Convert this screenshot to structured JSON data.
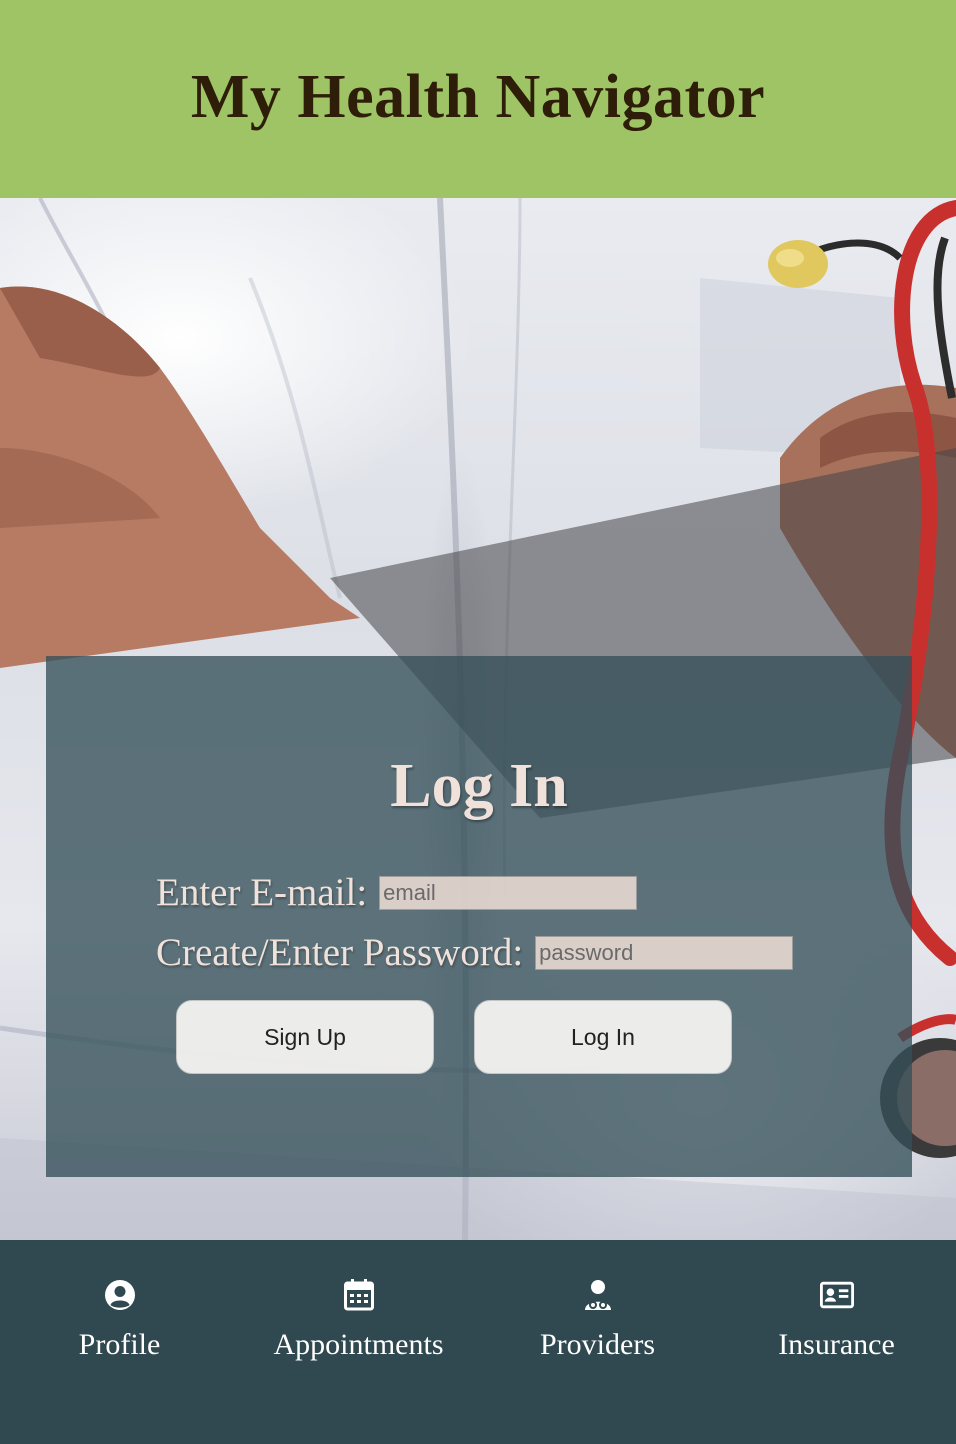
{
  "app": {
    "title": "My Health Navigator"
  },
  "login": {
    "title": "Log In",
    "email_label": "Enter E-mail:",
    "email_placeholder": "email",
    "password_label": "Create/Enter Password:",
    "password_placeholder": "password",
    "signup_button": "Sign Up",
    "login_button": "Log In"
  },
  "nav": {
    "items": [
      {
        "label": "Profile",
        "icon": "user-circle-icon"
      },
      {
        "label": "Appointments",
        "icon": "calendar-icon"
      },
      {
        "label": "Providers",
        "icon": "doctor-icon"
      },
      {
        "label": "Insurance",
        "icon": "id-card-icon"
      }
    ]
  },
  "colors": {
    "header_bg": "#9ec465",
    "title_text": "#2e1d08",
    "panel_bg": "#345058",
    "footer_bg": "#30484f"
  }
}
